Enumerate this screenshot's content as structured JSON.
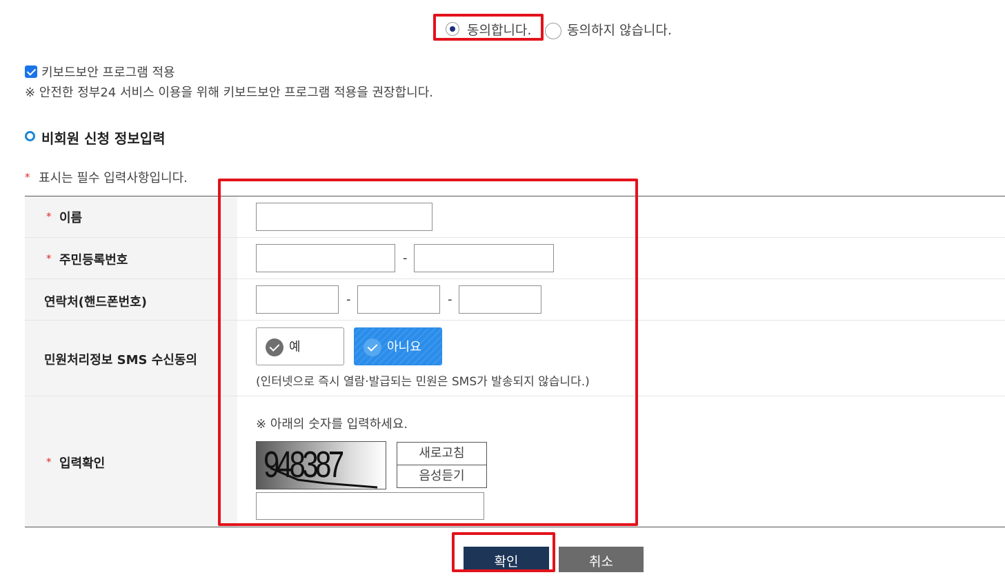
{
  "agreement": {
    "agree_label": "동의합니다.",
    "disagree_label": "동의하지 않습니다."
  },
  "keyboard_security": {
    "checkbox_label": "키보드보안 프로그램 적용",
    "notice": "※ 안전한 정부24 서비스 이용을 위해 키보드보안 프로그램 적용을 권장합니다."
  },
  "section": {
    "title": "비회원 신청 정보입력",
    "required_notice": "표시는 필수 입력사항입니다."
  },
  "required_mark": "*",
  "form": {
    "name_label": "이름",
    "resident_number_label": "주민등록번호",
    "phone_label": "연락처(핸드폰번호)",
    "sms_label": "민원처리정보 SMS 수신동의",
    "captcha_label": "입력확인",
    "dash": "-",
    "sms_yes": "예",
    "sms_no": "아니요",
    "sms_notice": "(인터넷으로 즉시 열람·발급되는 민원은 SMS가 발송되지 않습니다.)",
    "captcha_instruction": "※ 아래의 숫자를 입력하세요.",
    "captcha_value": "948387",
    "refresh_button": "새로고침",
    "audio_button": "음성듣기"
  },
  "buttons": {
    "confirm": "확인",
    "cancel": "취소"
  },
  "colors": {
    "highlight": "#e3121b",
    "confirm_bg": "#1d3557",
    "cancel_bg": "#6b6b6b",
    "selected_option": "#2b8de9"
  }
}
